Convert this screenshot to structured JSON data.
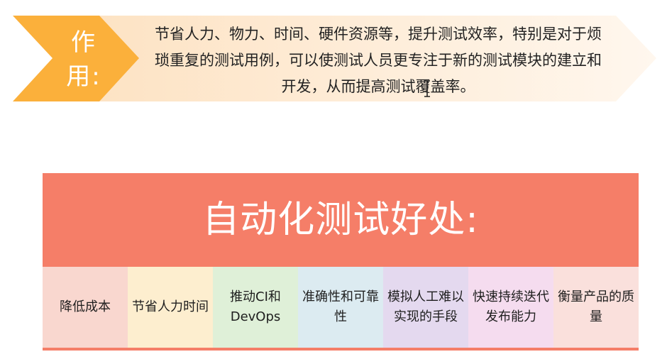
{
  "role": {
    "label_line1": "作",
    "label_line2": "用:",
    "text": "节省人力、物力、时间、硬件资源等，提升测试效率，特别是对于烦琐重复的测试用例，可以使测试人员更专注于新的测试模块的建立和开发，从而提高测试覆盖率。",
    "colors": {
      "arrow": "#fbb03b",
      "band": "#fde9cf",
      "band_light": "#fff6ea"
    }
  },
  "benefits": {
    "title": "自动化测试好处:",
    "header_color": "#f57e68",
    "items": [
      {
        "label": "降低成本",
        "color": "#f9d7cf"
      },
      {
        "label": "节省人力时间",
        "color": "#fdeecf"
      },
      {
        "label": "推动CI和DevOps",
        "color": "#dff0d8"
      },
      {
        "label": "准确性和可靠性",
        "color": "#dcebf1"
      },
      {
        "label": "模拟人工难以实现的手段",
        "color": "#e4d9ef"
      },
      {
        "label": "快速持续迭代发布能力",
        "color": "#f5dcef"
      },
      {
        "label": "衡量产品的质量",
        "color": "#fae0dc"
      }
    ]
  },
  "icons": {
    "cursor": "text-cursor-icon"
  }
}
